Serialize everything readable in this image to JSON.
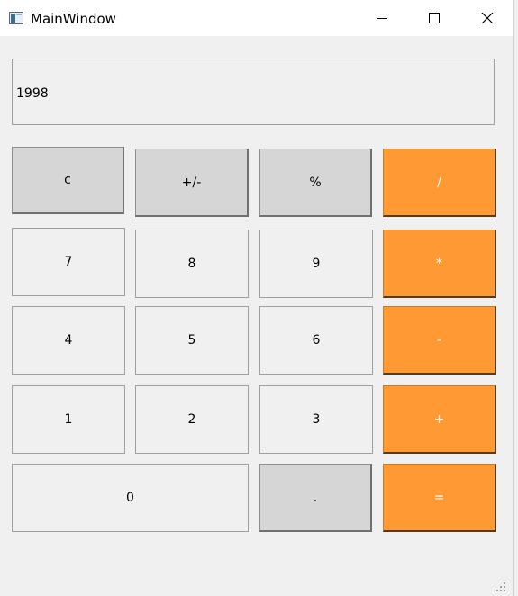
{
  "window": {
    "title": "MainWindow"
  },
  "display": {
    "value": "1998"
  },
  "keys": {
    "clear": "c",
    "negate": "+/-",
    "percent": "%",
    "divide": "/",
    "seven": "7",
    "eight": "8",
    "nine": "9",
    "multiply": "*",
    "four": "4",
    "five": "5",
    "six": "6",
    "subtract": "-",
    "one": "1",
    "two": "2",
    "three": "3",
    "add": "+",
    "zero": "0",
    "decimal": ".",
    "equals": "="
  },
  "colors": {
    "operator_key": "#ff9933",
    "function_key": "#d6d6d6",
    "digit_key": "#f0f0f0",
    "window_bg": "#f0f0f0"
  },
  "icons": {
    "app": "window-app-icon",
    "minimize": "minimize-icon",
    "maximize": "maximize-icon",
    "close": "close-icon",
    "resize": "resize-grip-icon"
  }
}
